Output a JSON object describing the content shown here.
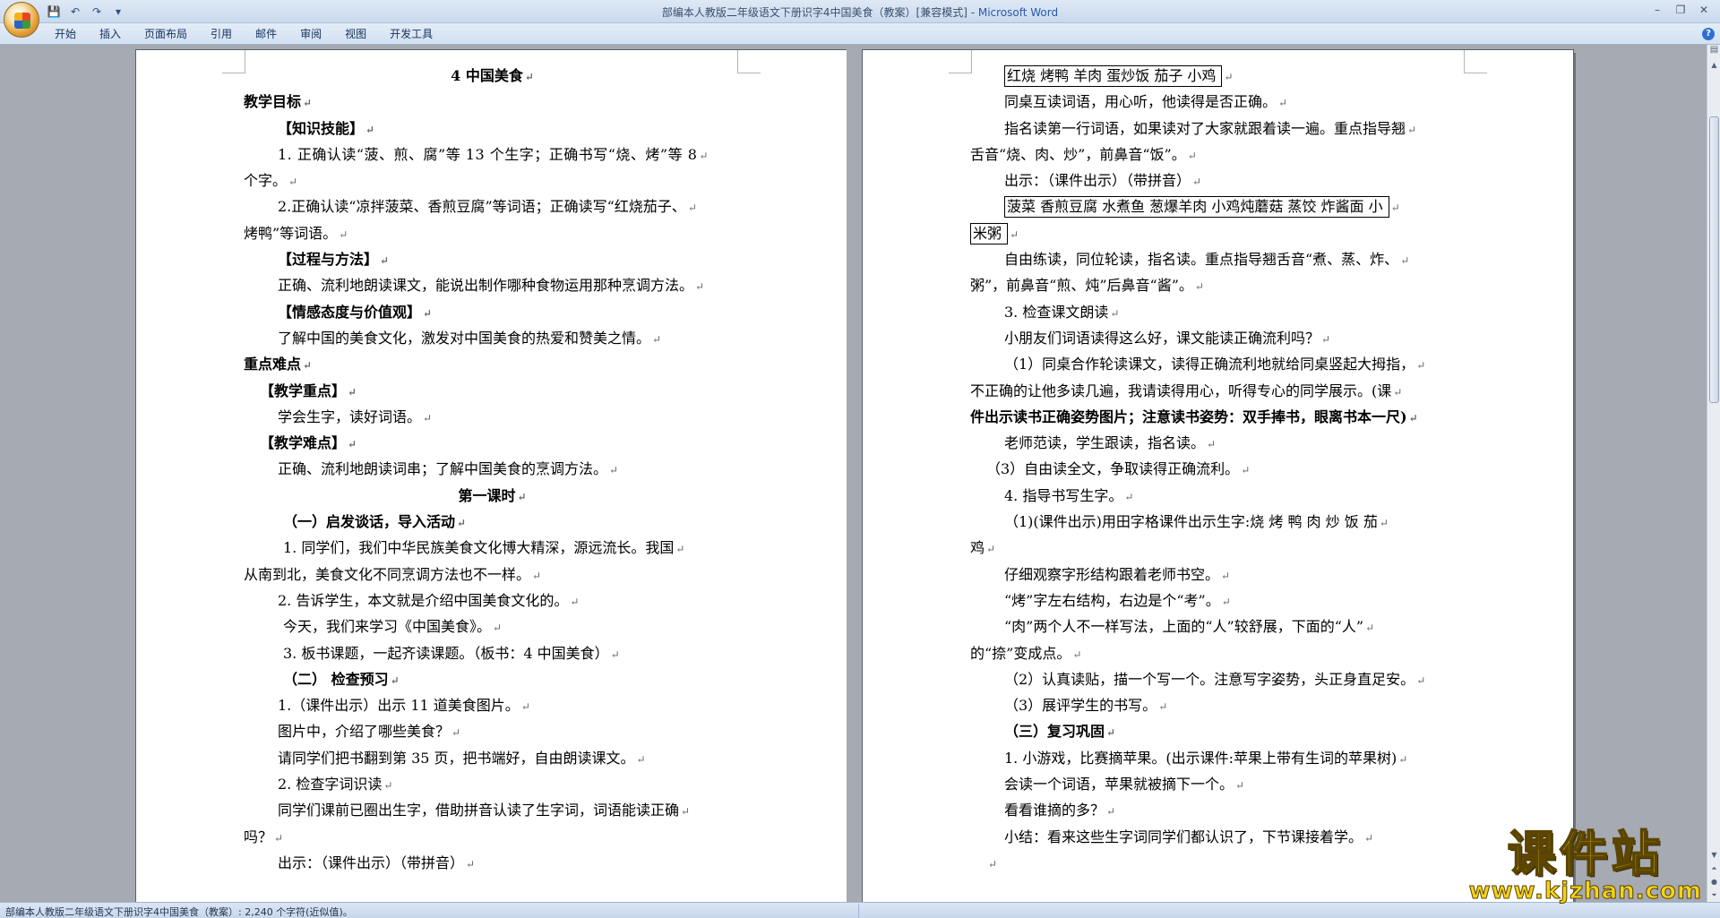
{
  "window": {
    "title": "部编本人教版二年级语文下册识字4中国美食（教案）[兼容模式] - ",
    "app_name": "Microsoft Word",
    "controls": [
      "–",
      "❐",
      "✕"
    ]
  },
  "qat": {
    "save_icon": "💾",
    "undo_icon": "↶",
    "redo_icon": "↷",
    "more_icon": "▾"
  },
  "ribbon": {
    "tabs": [
      "开始",
      "插入",
      "页面布局",
      "引用",
      "邮件",
      "审阅",
      "视图",
      "开发工具"
    ],
    "help_label": "?"
  },
  "status": {
    "text": "部编本人教版二年级语文下册识字4中国美食（教案）: 2,240 个字符(近似值)。"
  },
  "watermark": {
    "title": "课件站",
    "url": "www.kjzhan.com"
  },
  "colors": {
    "ribbon": "#d3e1f2",
    "doc_bg": "#a5aab3",
    "watermark": "#f4d21a"
  },
  "pages": {
    "left": [
      {
        "t": "4 中国美食",
        "c": "b center"
      },
      {
        "t": "教学目标",
        "c": "b"
      },
      {
        "t": "【知识技能】",
        "c": "b i1"
      },
      {
        "t": "1. 正确认读“菠、煎、腐”等 13 个生字；正确书写“烧、烤”等 8",
        "c": "i1 just"
      },
      {
        "t": "个字。",
        "c": ""
      },
      {
        "t": "2.正确认读“凉拌菠菜、香煎豆腐”等词语；正确读写“红烧茄子、",
        "c": "i1"
      },
      {
        "t": "烤鸭”等词语。",
        "c": ""
      },
      {
        "t": "【过程与方法】",
        "c": "b i1"
      },
      {
        "t": "正确、流利地朗读课文，能说出制作哪种食物运用那种烹调方法。",
        "c": "i1"
      },
      {
        "t": "【情感态度与价值观】",
        "c": "b i1"
      },
      {
        "t": "了解中国的美食文化，激发对中国美食的热爱和赞美之情。",
        "c": "i1"
      },
      {
        "t": "重点难点",
        "c": "b"
      },
      {
        "t": "【教学重点】",
        "c": "b i2"
      },
      {
        "t": "学会生字，读好词语。",
        "c": "i1"
      },
      {
        "t": "【教学难点】",
        "c": "b i2"
      },
      {
        "t": "正确、流利地朗读词串；了解中国美食的烹调方法。",
        "c": "i1"
      },
      {
        "t": "第一课时",
        "c": "b center"
      },
      {
        "t": "（一）启发谈话，导入活动",
        "c": "b i3"
      },
      {
        "t": "1. 同学们，我们中华民族美食文化博大精深，源远流长。我国",
        "c": "i3"
      },
      {
        "t": "从南到北，美食文化不同烹调方法也不一样。",
        "c": ""
      },
      {
        "t": "2. 告诉学生，本文就是介绍中国美食文化的。",
        "c": "i1"
      },
      {
        "t": "今天，我们来学习《中国美食》。",
        "c": "i3"
      },
      {
        "t": "3. 板书课题，一起齐读课题。（板书：4 中国美食）",
        "c": "i3"
      },
      {
        "t": "（二）  检查预习",
        "c": "b i3"
      },
      {
        "t": "1.（课件出示）出示 11 道美食图片。",
        "c": "i1"
      },
      {
        "t": "图片中，介绍了哪些美食？",
        "c": "i1"
      },
      {
        "t": "请同学们把书翻到第 35 页，把书端好，自由朗读课文。",
        "c": "i1"
      },
      {
        "t": "2. 检查字词识读",
        "c": "i1"
      },
      {
        "t": "同学们课前已圈出生字，借助拼音认读了生字词，词语能读正确",
        "c": "i1"
      },
      {
        "t": "吗？",
        "c": ""
      },
      {
        "t": "出示：（课件出示）（带拼音）",
        "c": "i1"
      }
    ],
    "right": [
      {
        "t": "红烧   烤鸭   羊肉   蛋炒饭    茄子   小鸡",
        "c": "i1",
        "box": true
      },
      {
        "t": "同桌互读词语，用心听，他读得是否正确。",
        "c": "i1"
      },
      {
        "t": "指名读第一行词语，如果读对了大家就跟着读一遍。重点指导翘",
        "c": "i1"
      },
      {
        "t": "舌音“烧、肉、炒”，前鼻音“饭”。",
        "c": ""
      },
      {
        "t": "出示：（课件出示）（带拼音）",
        "c": "i1"
      },
      {
        "t": "菠菜 香煎豆腐 水煮鱼 葱爆羊肉 小鸡炖蘑菇 蒸饺 炸酱面 小",
        "c": "i1",
        "box": true
      },
      {
        "t": "米粥",
        "c": "",
        "box": true
      },
      {
        "t": "自由练读，同位轮读，指名读。重点指导翘舌音“煮、蒸、炸、",
        "c": "i1"
      },
      {
        "t": "粥”，前鼻音“煎、炖”后鼻音“酱”。",
        "c": ""
      },
      {
        "t": "3. 检查课文朗读",
        "c": "i1"
      },
      {
        "t": "小朋友们词语读得这么好，课文能读正确流利吗？",
        "c": "i1"
      },
      {
        "t": "（1）同桌合作轮读课文，读得正确流利地就给同桌竖起大拇指，",
        "c": "i1"
      },
      {
        "t": "不正确的让他多读几遍，我请读得用心，听得专心的同学展示。(课",
        "c": ""
      },
      {
        "t": "件出示读书正确姿势图片；注意读书姿势：双手捧书，眼离书本一尺)",
        "c": "b"
      },
      {
        "t": "老师范读，学生跟读，指名读。",
        "c": "i1"
      },
      {
        "t": "（3）自由读全文，争取读得正确流利。",
        "c": "i2"
      },
      {
        "t": "4. 指导书写生字。",
        "c": "i1"
      },
      {
        "t": "（1)(课件出示)用田字格课件出示生字:烧 烤 鸭 肉 炒 饭 茄",
        "c": "i1"
      },
      {
        "t": "鸡",
        "c": ""
      },
      {
        "t": "仔细观察字形结构跟着老师书空。",
        "c": "i1"
      },
      {
        "t": "“烤”字左右结构，右边是个“考”。",
        "c": "i1"
      },
      {
        "t": "“肉”两个人不一样写法，上面的“人”较舒展，下面的“人”",
        "c": "i1"
      },
      {
        "t": "的“捺”变成点。",
        "c": ""
      },
      {
        "t": "（2）认真读贴，描一个写一个。注意写字姿势，头正身直足安。",
        "c": "i1"
      },
      {
        "t": "（3）展评学生的书写。",
        "c": "i1"
      },
      {
        "t": "（三）复习巩固",
        "c": "b i1"
      },
      {
        "t": "1. 小游戏，比赛摘苹果。(出示课件:苹果上带有生词的苹果树)",
        "c": "i1"
      },
      {
        "t": "会读一个词语，苹果就被摘下一个。",
        "c": "i1"
      },
      {
        "t": "看看谁摘的多？",
        "c": "i1"
      },
      {
        "t": "小结：看来这些生字词同学们都认识了，下节课接着学。",
        "c": "i1"
      },
      {
        "t": "",
        "c": "i2"
      }
    ]
  }
}
